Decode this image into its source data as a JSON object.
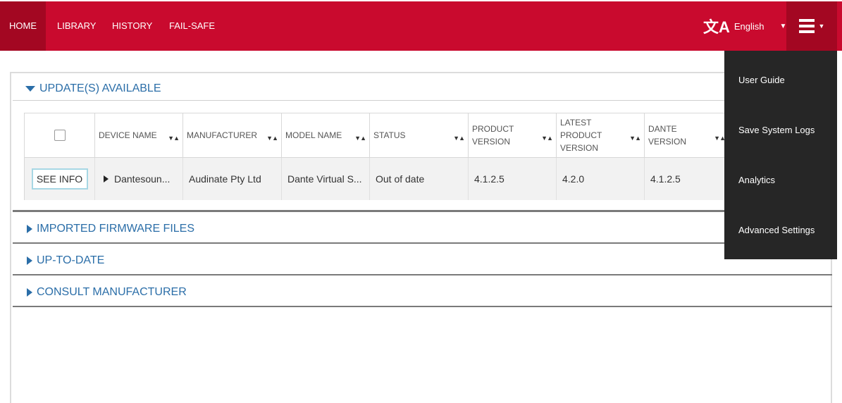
{
  "nav": {
    "items": [
      "HOME",
      "LIBRARY",
      "HISTORY",
      "FAIL-SAFE"
    ],
    "language": "English",
    "language_icon": "translate-icon",
    "menu_icon": "hamburger-menu-icon"
  },
  "sections": {
    "updates": "UPDATE(S) AVAILABLE",
    "imported": "IMPORTED FIRMWARE FILES",
    "uptodate": "UP-TO-DATE",
    "consult": "CONSULT MANUFACTURER"
  },
  "table": {
    "headers": {
      "device_name": "DEVICE NAME",
      "manufacturer": "MANUFACTURER",
      "model_name": "MODEL NAME",
      "status": "STATUS",
      "product_version": "PRODUCT VERSION",
      "latest_product_version": "LATEST PRODUCT VERSION",
      "dante_version": "DANTE VERSION"
    },
    "rows": [
      {
        "action": "SEE INFO",
        "device_name": "Dantesoun...",
        "manufacturer": "Audinate Pty Ltd",
        "model_name": "Dante Virtual S...",
        "status": "Out of date",
        "product_version": "4.1.2.5",
        "latest_product_version": "4.2.0",
        "dante_version": "4.1.2.5"
      }
    ]
  },
  "menu": {
    "items": [
      "User Guide",
      "Save System Logs",
      "Analytics",
      "Advanced Settings"
    ]
  },
  "colors": {
    "brand_red": "#c90a2e",
    "brand_red_dark": "#a30722",
    "section_blue": "#2b6ea8",
    "menu_bg": "#262626"
  }
}
